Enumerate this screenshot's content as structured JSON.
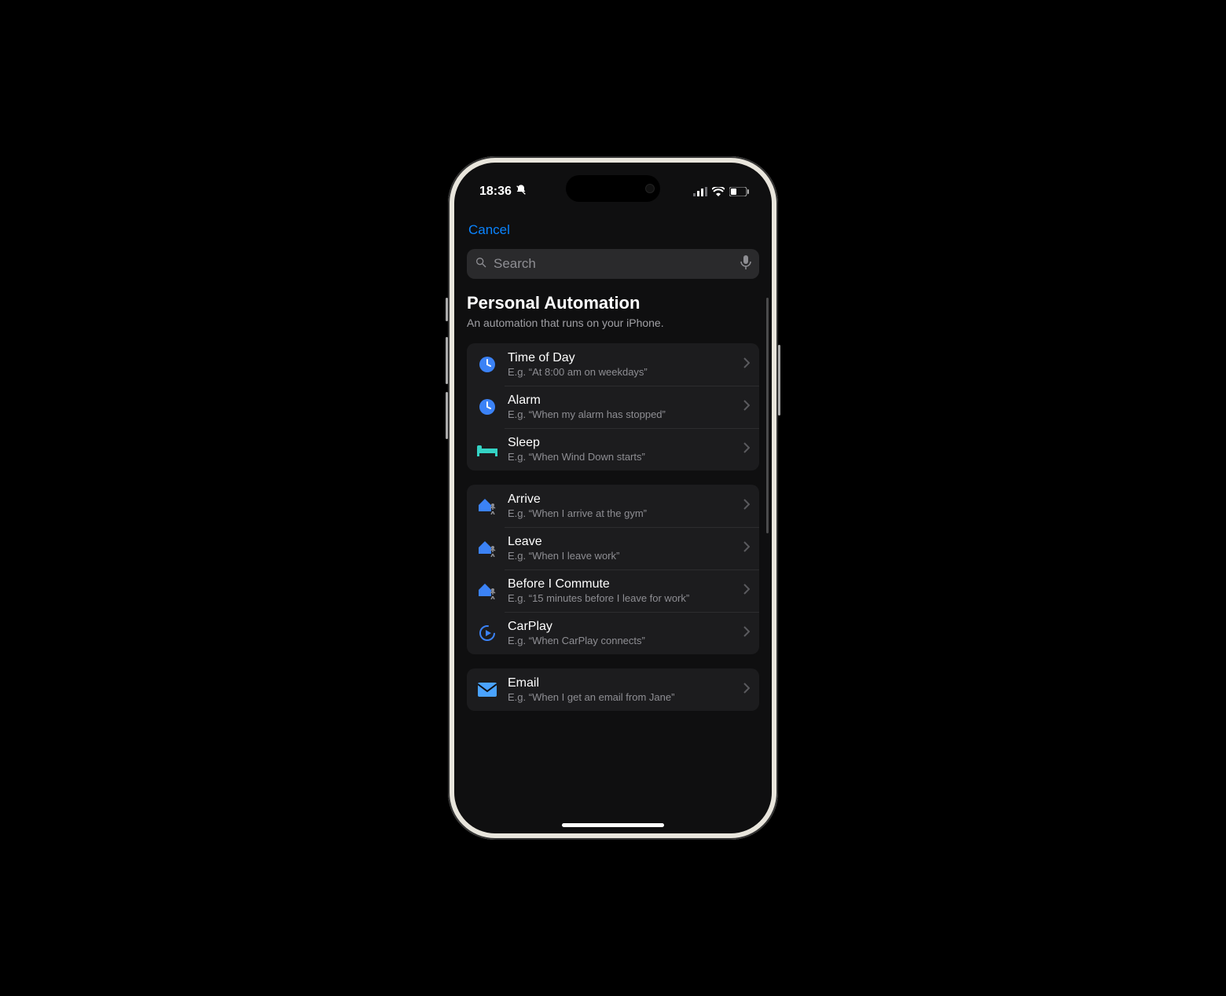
{
  "status": {
    "time": "18:36",
    "silent_icon": "bell-slash",
    "signal_bars": 3,
    "wifi": true,
    "battery_level": "low"
  },
  "nav": {
    "cancel": "Cancel"
  },
  "search": {
    "placeholder": "Search"
  },
  "header": {
    "title": "Personal Automation",
    "subtitle": "An automation that runs on your iPhone."
  },
  "groups": [
    {
      "rows": [
        {
          "icon": "clock",
          "icon_color": "#3b82f6",
          "title": "Time of Day",
          "sub": "E.g. “At 8:00 am on weekdays”"
        },
        {
          "icon": "clock",
          "icon_color": "#3b82f6",
          "title": "Alarm",
          "sub": "E.g. “When my alarm has stopped”"
        },
        {
          "icon": "bed",
          "icon_color": "#34d3c5",
          "title": "Sleep",
          "sub": "E.g. “When Wind Down starts”"
        }
      ]
    },
    {
      "rows": [
        {
          "icon": "house-person",
          "icon_color": "#3b82f6",
          "title": "Arrive",
          "sub": "E.g. “When I arrive at the gym”"
        },
        {
          "icon": "house-person",
          "icon_color": "#3b82f6",
          "title": "Leave",
          "sub": "E.g. “When I leave work”"
        },
        {
          "icon": "house-person",
          "icon_color": "#3b82f6",
          "title": "Before I Commute",
          "sub": "E.g. “15 minutes before I leave for work”"
        },
        {
          "icon": "carplay",
          "icon_color": "#3b82f6",
          "title": "CarPlay",
          "sub": "E.g. “When CarPlay connects”"
        }
      ]
    },
    {
      "rows": [
        {
          "icon": "mail",
          "icon_color": "#4aa3ff",
          "title": "Email",
          "sub": "E.g. “When I get an email from Jane”"
        }
      ]
    }
  ]
}
